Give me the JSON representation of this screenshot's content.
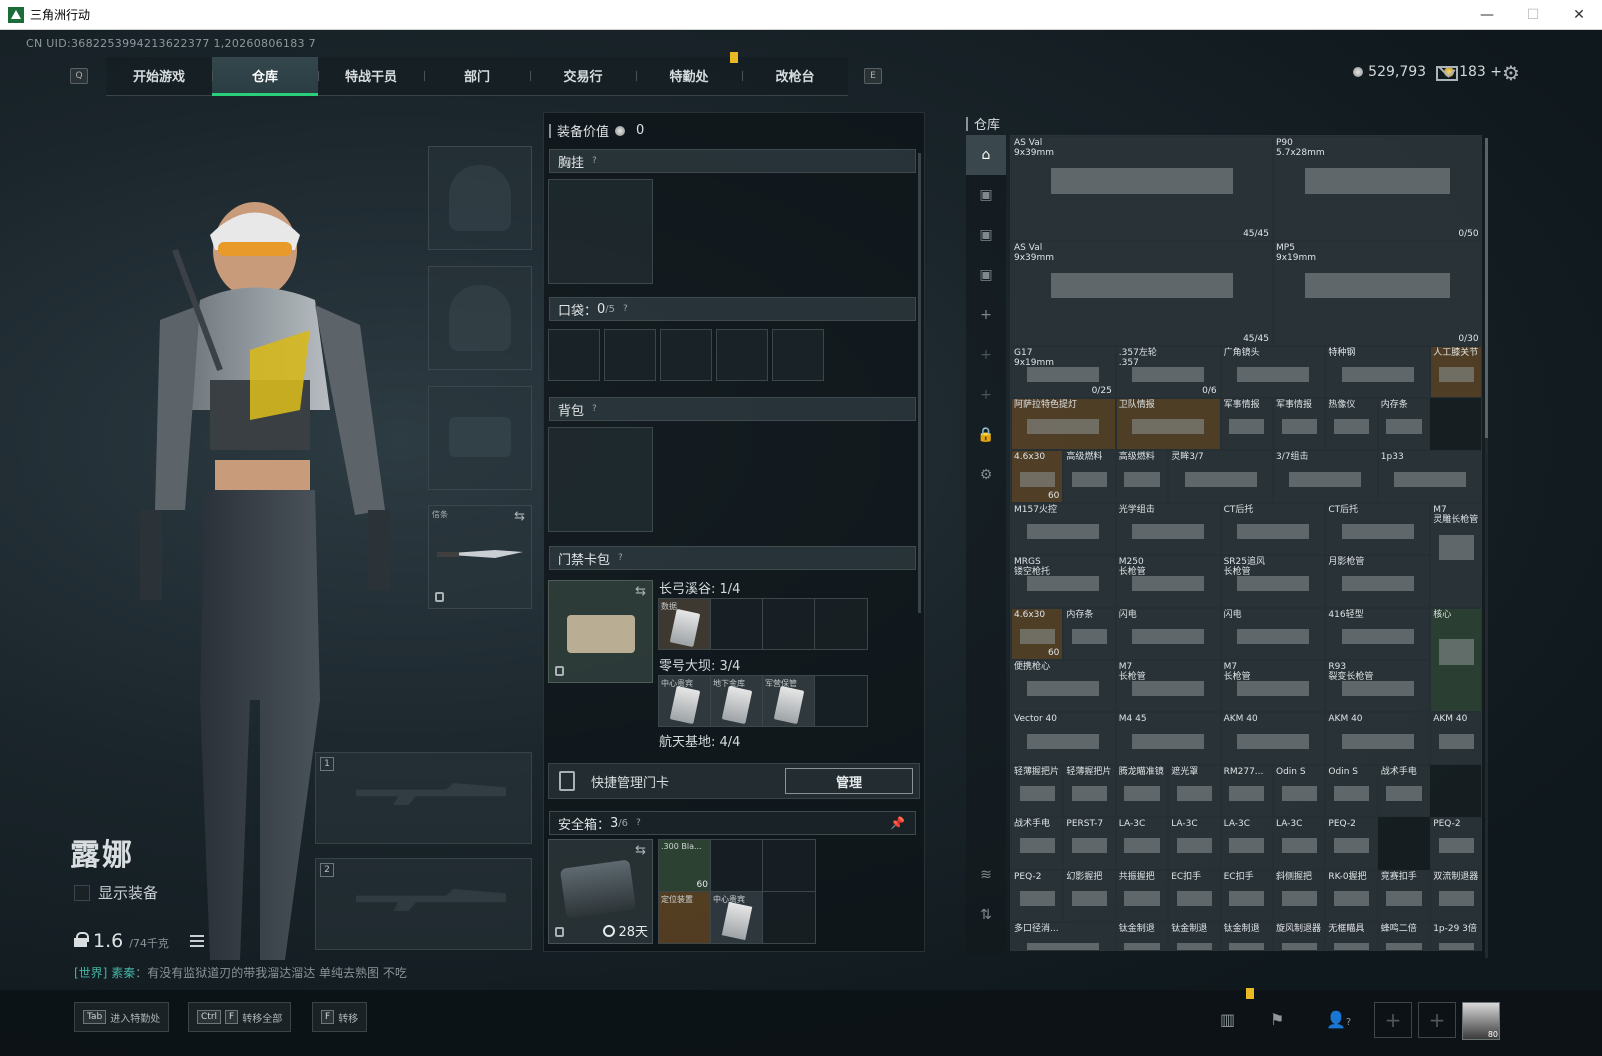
{
  "window": {
    "title": "三角洲行动",
    "minimize": "—",
    "maximize": "☐",
    "close": "✕"
  },
  "uid": "CN UID:3682253994213622377 1,20260806183 7",
  "nav": {
    "left_key": "Q",
    "right_key": "E",
    "tabs": [
      {
        "label": "开始游戏"
      },
      {
        "label": "仓库",
        "active": true
      },
      {
        "label": "特战干员"
      },
      {
        "label": "部门"
      },
      {
        "label": "交易行"
      },
      {
        "label": "特勤处"
      },
      {
        "label": "改枪台"
      }
    ]
  },
  "currency": {
    "silver": "529,793",
    "gold": "183",
    "gold_plus": "+"
  },
  "character": {
    "name": "露娜",
    "show_equip_label": "显示装备",
    "weight": "1.6",
    "weight_max": "/74千克",
    "chat": {
      "channel": "[世界]",
      "speaker": "素秦",
      "text": "：有没有监狱道刃的带我溜达溜达 单纯去熟图 不吃"
    }
  },
  "equipment": {
    "melee_label": "信条",
    "gun_slot_1": "1",
    "gun_slot_2": "2"
  },
  "loadout": {
    "value_label": "装备价值",
    "value": "0",
    "chest_rig": "胸挂",
    "pockets": "口袋：",
    "pockets_used": "0",
    "pockets_max": "/5",
    "backpack": "背包",
    "keycard_bag": "门禁卡包",
    "maps": [
      {
        "name": "长弓溪谷: 1/4",
        "cells": [
          "数据",
          "",
          "",
          ""
        ]
      },
      {
        "name": "零号大坝: 3/4",
        "cells": [
          "中心贵宾",
          "地下金库",
          "军营保管",
          ""
        ]
      },
      {
        "name": "航天基地: 4/4",
        "cells": []
      }
    ],
    "quick_manage": "快捷管理门卡",
    "manage_btn": "管理",
    "safebox_label": "安全箱：",
    "safebox_used": "3",
    "safebox_max": "/6",
    "safebox_days": "28天",
    "safe_items": [
      {
        "name": ".300 Bla...",
        "count": "60"
      },
      {
        "name": "定位装置"
      },
      {
        "name": "中心贵宾"
      }
    ]
  },
  "warehouse": {
    "title": "仓库",
    "items": [
      {
        "name": "AS Val\n9x39mm",
        "ammo": "45/45"
      },
      {
        "name": "P90\n5.7x28mm",
        "ammo": "0/50"
      },
      {
        "name": "AS Val\n9x39mm",
        "ammo": "45/45"
      },
      {
        "name": "MP5\n9x19mm",
        "ammo": "0/30"
      },
      {
        "name": "G17\n9x19mm",
        "ammo": "0/25"
      },
      {
        "name": ".357左轮\n.357",
        "ammo": "0/6"
      },
      {
        "name": "广角镜头"
      },
      {
        "name": "特种钢"
      },
      {
        "name": "人工膝关节"
      },
      {
        "name": "阿萨拉特色提灯"
      },
      {
        "name": "卫队情报"
      },
      {
        "name": "军事情报"
      },
      {
        "name": "军事情报"
      },
      {
        "name": "热像仪"
      },
      {
        "name": "内存条"
      },
      {
        "name": "4.6x30",
        "ammo": "60"
      },
      {
        "name": "高级燃料"
      },
      {
        "name": "高级燃料"
      },
      {
        "name": "灵眸3/7"
      },
      {
        "name": "3/7组击"
      },
      {
        "name": "1p33"
      },
      {
        "name": "M157火控"
      },
      {
        "name": "光学组击"
      },
      {
        "name": "CT后托"
      },
      {
        "name": "CT后托"
      },
      {
        "name": "M7\n灵雕长枪管"
      },
      {
        "name": "MRGS\n镂空枪托"
      },
      {
        "name": "M250\n长枪管"
      },
      {
        "name": "SR25追风\n长枪管"
      },
      {
        "name": "月影枪管"
      },
      {
        "name": "4.6x30",
        "ammo": "60"
      },
      {
        "name": "内存条"
      },
      {
        "name": "闪电"
      },
      {
        "name": "闪电"
      },
      {
        "name": "416轻型"
      },
      {
        "name": "核心"
      },
      {
        "name": "便携枪心"
      },
      {
        "name": "M7\n长枪管"
      },
      {
        "name": "M7\n长枪管"
      },
      {
        "name": "R93\n裂变长枪管"
      },
      {
        "name": "Vector 40"
      },
      {
        "name": "M4 45"
      },
      {
        "name": "AKM 40"
      },
      {
        "name": "AKM 40"
      },
      {
        "name": "AKM 40"
      },
      {
        "name": "轻薄握把片"
      },
      {
        "name": "轻薄握把片"
      },
      {
        "name": "腾龙瞄准镜"
      },
      {
        "name": "遮光罩"
      },
      {
        "name": "RM277..."
      },
      {
        "name": "Odin S"
      },
      {
        "name": "Odin S"
      },
      {
        "name": "战术手电"
      },
      {
        "name": "战术手电"
      },
      {
        "name": "PERST-7"
      },
      {
        "name": "LA-3C"
      },
      {
        "name": "LA-3C"
      },
      {
        "name": "LA-3C"
      },
      {
        "name": "LA-3C"
      },
      {
        "name": "PEQ-2"
      },
      {
        "name": "PEQ-2"
      },
      {
        "name": "PEQ-2"
      },
      {
        "name": "幻影握把"
      },
      {
        "name": "共振握把"
      },
      {
        "name": "EC扣手"
      },
      {
        "name": "EC扣手"
      },
      {
        "name": "斜侧握把"
      },
      {
        "name": "RK-0握把"
      },
      {
        "name": "竞赛扣手"
      },
      {
        "name": "双流制退器"
      },
      {
        "name": "多口径消..."
      },
      {
        "name": "钛金制退"
      },
      {
        "name": "钛金制退"
      },
      {
        "name": "钛金制退"
      },
      {
        "name": "旋风制退器"
      },
      {
        "name": "无框瞄具"
      },
      {
        "name": "蜂鸣二倍"
      },
      {
        "name": "1p-29 3倍"
      }
    ]
  },
  "bottom": {
    "hints": [
      {
        "key": "Tab",
        "label": "进入特勤处"
      },
      {
        "key": "Ctrl",
        "key2": "F",
        "label": "转移全部"
      },
      {
        "key": "F",
        "label": "转移"
      }
    ],
    "friends_count": "?",
    "avatar_level": "80"
  },
  "colors": {
    "accent_green": "#29d17b",
    "notif_yellow": "#e8b923"
  }
}
